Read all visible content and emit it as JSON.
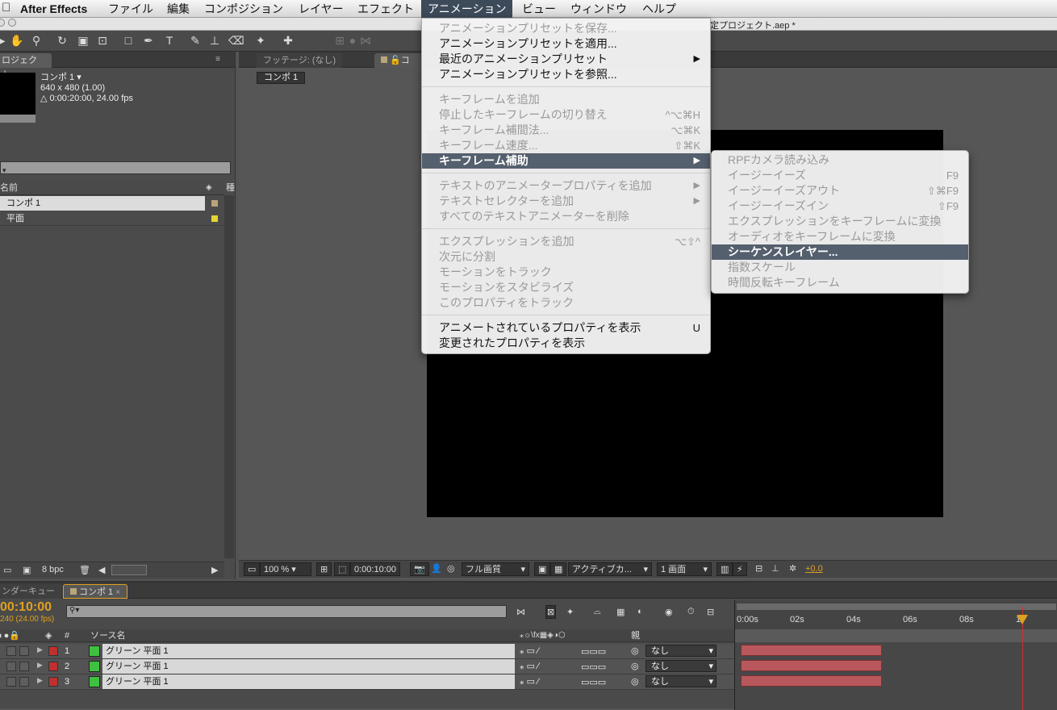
{
  "menubar": {
    "app": "After Effects",
    "items": [
      "ファイル",
      "編集",
      "コンポジション",
      "レイヤー",
      "エフェクト",
      "アニメーション",
      "ビュー",
      "ウィンドウ",
      "ヘルプ"
    ]
  },
  "window_title": "定プロジェクト.aep *",
  "project_panel": {
    "tab": "ロジェクト",
    "comp_name": "コンポ 1 ▾",
    "comp_size": "640 x 480 (1.00)",
    "comp_duration": "△ 0:00:20:00, 24.00 fps",
    "col_name": "名前",
    "col_type": "種",
    "items": [
      "コンポ 1",
      "平面"
    ],
    "bpc": "8 bpc"
  },
  "viewer": {
    "tab_footage": "フッテージ: (なし)",
    "tab_comp": "コ",
    "comp_button": "コンポ 1",
    "zoom": "100 %",
    "timecode": "0:00:10:00",
    "resolution": "フル画質",
    "camera": "アクティブカ...",
    "views": "1 画面",
    "exposure": "+0.0"
  },
  "timeline": {
    "tab_render": "ンダーキュー",
    "tab_comp": "コンポ 1",
    "current_time": "00:10:00",
    "frame_info": "240 (24.00 fps)",
    "col_source": "ソース名",
    "col_num": "#",
    "col_parent": "親",
    "ruler": [
      "0:00s",
      "02s",
      "04s",
      "06s",
      "08s",
      "1"
    ],
    "layers": [
      {
        "num": "1",
        "name": "グリーン 平面 1",
        "parent": "なし"
      },
      {
        "num": "2",
        "name": "グリーン 平面 1",
        "parent": "なし"
      },
      {
        "num": "3",
        "name": "グリーン 平面 1",
        "parent": "なし"
      }
    ]
  },
  "animation_menu": {
    "items": [
      {
        "label": "アニメーションプリセットを保存...",
        "shortcut": "",
        "enabled": false
      },
      {
        "label": "アニメーションプリセットを適用...",
        "shortcut": "",
        "enabled": true
      },
      {
        "label": "最近のアニメーションプリセット",
        "shortcut": "▶",
        "enabled": true
      },
      {
        "label": "アニメーションプリセットを参照...",
        "shortcut": "",
        "enabled": true
      },
      {
        "label": "キーフレームを追加",
        "shortcut": "",
        "enabled": false
      },
      {
        "label": "停止したキーフレームの切り替え",
        "shortcut": "^⌥⌘H",
        "enabled": false
      },
      {
        "label": "キーフレーム補間法...",
        "shortcut": "⌥⌘K",
        "enabled": false
      },
      {
        "label": "キーフレーム速度...",
        "shortcut": "⇧⌘K",
        "enabled": false
      },
      {
        "label": "キーフレーム補助",
        "shortcut": "▶",
        "enabled": true
      },
      {
        "label": "テキストのアニメータープロパティを追加",
        "shortcut": "▶",
        "enabled": false
      },
      {
        "label": "テキストセレクターを追加",
        "shortcut": "▶",
        "enabled": false
      },
      {
        "label": "すべてのテキストアニメーターを削除",
        "shortcut": "",
        "enabled": false
      },
      {
        "label": "エクスプレッションを追加",
        "shortcut": "⌥⇧^",
        "enabled": false
      },
      {
        "label": "次元に分割",
        "shortcut": "",
        "enabled": false
      },
      {
        "label": "モーションをトラック",
        "shortcut": "",
        "enabled": false
      },
      {
        "label": "モーションをスタビライズ",
        "shortcut": "",
        "enabled": false
      },
      {
        "label": "このプロパティをトラック",
        "shortcut": "",
        "enabled": false
      },
      {
        "label": "アニメートされているプロパティを表示",
        "shortcut": "U",
        "enabled": true
      },
      {
        "label": "変更されたプロパティを表示",
        "shortcut": "",
        "enabled": true
      }
    ]
  },
  "keyframe_assistant_submenu": {
    "items": [
      {
        "label": "RPFカメラ読み込み",
        "shortcut": ""
      },
      {
        "label": "イージーイーズ",
        "shortcut": "F9"
      },
      {
        "label": "イージーイーズアウト",
        "shortcut": "⇧⌘F9"
      },
      {
        "label": "イージーイーズイン",
        "shortcut": "⇧F9"
      },
      {
        "label": "エクスプレッションをキーフレームに変換",
        "shortcut": ""
      },
      {
        "label": "オーディオをキーフレームに変換",
        "shortcut": ""
      },
      {
        "label": "シーケンスレイヤー...",
        "shortcut": ""
      },
      {
        "label": "指数スケール",
        "shortcut": ""
      },
      {
        "label": "時間反転キーフレーム",
        "shortcut": ""
      }
    ]
  },
  "colors": {
    "highlight": "#55606e",
    "playhead": "#d03030",
    "timecode": "#e0a020",
    "label_red": "#c03030",
    "label_green": "#40c040"
  }
}
